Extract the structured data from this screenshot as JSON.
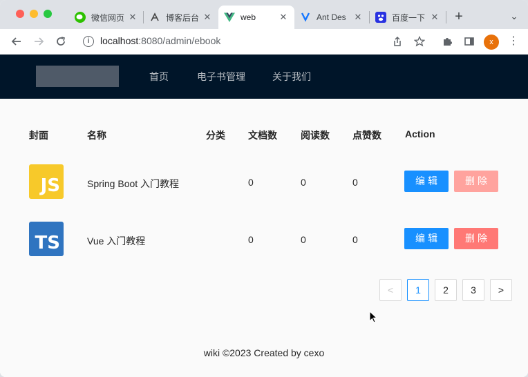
{
  "browser": {
    "tabs": [
      {
        "title": "微信网页",
        "favicon": "wechat-icon"
      },
      {
        "title": "博客后台",
        "favicon": "blog-icon"
      },
      {
        "title": "web",
        "favicon": "vue-icon",
        "active": true
      },
      {
        "title": "Ant Des",
        "favicon": "ant-design-icon"
      },
      {
        "title": "百度一下",
        "favicon": "baidu-icon"
      }
    ],
    "url_host": "localhost",
    "url_path": ":8080/admin/ebook",
    "profile_initial": "x"
  },
  "nav": {
    "items": [
      "首页",
      "电子书管理",
      "关于我们"
    ]
  },
  "table": {
    "headers": [
      "封面",
      "名称",
      "分类",
      "文档数",
      "阅读数",
      "点赞数",
      "Action"
    ],
    "rows": [
      {
        "cover_text": "JS",
        "name": "Spring Boot 入门教程",
        "category": "",
        "docs": "0",
        "views": "0",
        "likes": "0",
        "edit": "编辑",
        "delete": "删除"
      },
      {
        "cover_text": "TS",
        "name": "Vue 入门教程",
        "category": "",
        "docs": "0",
        "views": "0",
        "likes": "0",
        "edit": "编辑",
        "delete": "删除"
      }
    ]
  },
  "pagination": {
    "pages": [
      "1",
      "2",
      "3"
    ],
    "prev": "<",
    "next": ">"
  },
  "footer": {
    "text": "wiki ©2023 Created by cexo"
  },
  "colors": {
    "header_bg": "#001529",
    "primary": "#1890ff",
    "danger": "#ff7875"
  }
}
